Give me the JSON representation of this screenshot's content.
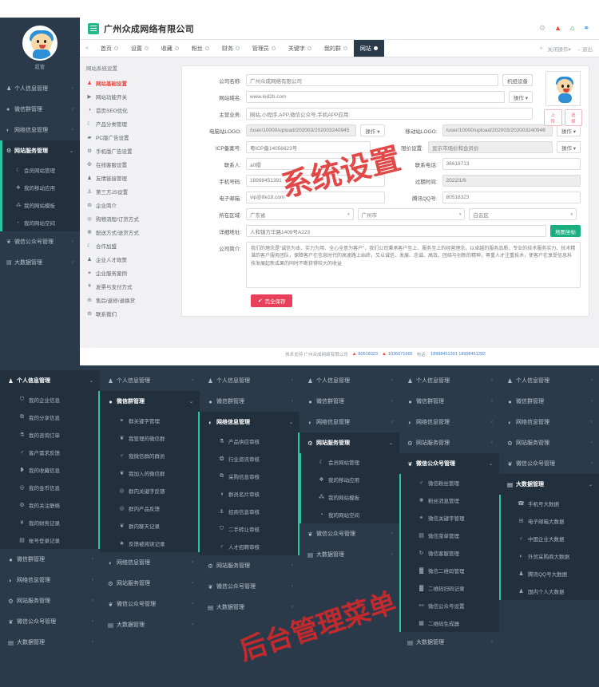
{
  "main": {
    "header": {
      "brand": "广州众成网络有限公司",
      "menu_icon": "hamburger-icon",
      "icons": [
        {
          "name": "gear-icon",
          "glyph": "⚙"
        },
        {
          "name": "bell-icon",
          "glyph": "▲"
        },
        {
          "name": "home-icon",
          "glyph": "⌂"
        },
        {
          "name": "link-icon",
          "glyph": "⚭"
        }
      ]
    },
    "tabbar": {
      "prev_glyph": "«",
      "tabs": [
        {
          "label": "首页",
          "dot": true,
          "active": false
        },
        {
          "label": "设置",
          "dot": true,
          "active": false
        },
        {
          "label": "收藏",
          "dot": true,
          "active": false
        },
        {
          "label": "粉丝",
          "dot": true,
          "active": false
        },
        {
          "label": "财务",
          "dot": true,
          "active": false
        },
        {
          "label": "管理员",
          "dot": true,
          "active": false
        },
        {
          "label": "关键字",
          "dot": true,
          "active": false
        },
        {
          "label": "我的群",
          "dot": true,
          "active": false
        },
        {
          "label": "网站",
          "dot": true,
          "active": true
        }
      ],
      "right": [
        {
          "label": "»"
        },
        {
          "label": "关闭操作▾"
        },
        {
          "label": "→ 退出"
        }
      ]
    },
    "sidebar": {
      "avatar_name": "超管",
      "items": [
        {
          "label": "个人信息管理",
          "icon": "user-icon",
          "glyph": "♟",
          "arrow": "‹",
          "active": false
        },
        {
          "label": "微信群管理",
          "icon": "chat-icon",
          "glyph": "●",
          "arrow": "‹",
          "active": false
        },
        {
          "label": "网络信息管理",
          "icon": "info-icon",
          "glyph": "◐",
          "arrow": "‹",
          "active": false
        },
        {
          "label": "网站服务管理",
          "icon": "gear-icon",
          "glyph": "⚙",
          "arrow": "⌄",
          "active": true
        }
      ],
      "sub_items": [
        {
          "label": "会员网站管理",
          "glyph": "☾"
        },
        {
          "label": "我的移动应用",
          "glyph": "❖"
        },
        {
          "label": "我的网站模板",
          "glyph": "⁂"
        },
        {
          "label": "我的网站空间",
          "glyph": "◔"
        }
      ],
      "tail_items": [
        {
          "label": "微信公众号管理",
          "glyph": "❦",
          "arrow": "‹"
        },
        {
          "label": "大数据管理",
          "glyph": "▤",
          "arrow": "‹"
        }
      ]
    },
    "submenu": {
      "title": "网站系统设置",
      "items": [
        {
          "label": "网站基础设置",
          "glyph": "♟",
          "selected": true
        },
        {
          "label": "网站功能开关",
          "glyph": "▶",
          "selected": false
        },
        {
          "label": "首页SEO优化",
          "glyph": "◑",
          "selected": false
        },
        {
          "label": "产品分类管理",
          "glyph": "☾",
          "selected": false
        },
        {
          "label": "PC版广告设置",
          "glyph": "▰",
          "selected": false
        },
        {
          "label": "手机版广告设置",
          "glyph": "⚙",
          "selected": false
        },
        {
          "label": "在线客服设置",
          "glyph": "✠",
          "selected": false
        },
        {
          "label": "友情链接管理",
          "glyph": "♟",
          "selected": false
        },
        {
          "label": "第三方JS设置",
          "glyph": "⚓",
          "selected": false
        },
        {
          "label": "企业简介",
          "glyph": "⚙",
          "selected": false
        },
        {
          "label": "购物流程/订货方式",
          "glyph": "◎",
          "selected": false
        },
        {
          "label": "配送方式/送货方式",
          "glyph": "☸",
          "selected": false
        },
        {
          "label": "合作加盟",
          "glyph": "☾",
          "selected": false
        },
        {
          "label": "企业人才政策",
          "glyph": "♟",
          "selected": false
        },
        {
          "label": "企业服务案例",
          "glyph": "⚭",
          "selected": false
        },
        {
          "label": "发票与支付方式",
          "glyph": "¥",
          "selected": false
        },
        {
          "label": "售后/返修/退换货",
          "glyph": "⚙",
          "selected": false
        },
        {
          "label": "联系我们",
          "glyph": "⚙",
          "selected": false
        }
      ]
    },
    "form": {
      "rows": [
        {
          "label": "公司名称:",
          "value": "广州众成网络有限公司",
          "btn": "机组设备",
          "grey": false
        },
        {
          "label": "网站域名:",
          "value": "www.led2b.com",
          "btn": "操作 ▾",
          "grey": false
        },
        {
          "label": "主营业务:",
          "value": "网站,小程序,APP,微信公众号,手机APP应用",
          "btn": "",
          "grey": false
        }
      ],
      "pair_rows": [
        {
          "left_label": "电脑站LOGO:",
          "left_value": "/user/10000/upload/202003/202003240945",
          "left_btn": "操作 ▾",
          "left_grey": true,
          "right_label": "移动站LOGO:",
          "right_value": "/user/10000/upload/202003/202003240946",
          "right_btn": "操作 ▾",
          "right_grey": true
        },
        {
          "left_label": "ICP备案号:",
          "left_value": "粤ICP备14056623号",
          "left_btn": "",
          "left_grey": false,
          "right_label": "限价设置:",
          "right_value": "显示市场价和会员价",
          "right_btn": "操作 ▾",
          "right_grey": true
        },
        {
          "left_label": "联系人:",
          "left_value": "a0帽",
          "left_btn": "",
          "left_grey": false,
          "right_label": "联系电话:",
          "right_value": "36618713",
          "right_btn": "",
          "right_grey": false
        },
        {
          "left_label": "手机号码:",
          "left_value": "18998451391",
          "left_btn": "",
          "left_grey": false,
          "right_label": "过期时间:",
          "right_value": "2022/1/6",
          "right_btn": "",
          "right_grey": true
        },
        {
          "left_label": "电子邮箱:",
          "left_value": "vip@8e18.com",
          "left_btn": "",
          "left_grey": false,
          "right_label": "腾讯QQ号:",
          "right_value": "80518323",
          "right_btn": "",
          "right_grey": false
        }
      ],
      "region": {
        "label": "所在区域:",
        "province": "广东省",
        "city": "广州市",
        "district": "白云区"
      },
      "address": {
        "label": "详细地址:",
        "value": "人和镇方华路1409号A223",
        "map_btn": "地图坐标"
      },
      "intro": {
        "label": "公司简介:",
        "value": "我们的理念是\"诚信为本、实力为用、全心全意为客户\"，我们公司秉承客户至上、服务至上的经营理念，以卓越的服务品质、专业的技术服务实力、技术精湛的客户服务团队，保障客户在信息时代的高速路上始终，又以诚信、发展、忠诚、高效、团结与创新的精神，尊重人才注重技术，使客户在享受信息科技发展起新成果的同时不断获得较大的收益"
      },
      "save_label": "完全保存",
      "logo_panel": {
        "upload_label": "上传",
        "choose_label": "选择"
      }
    },
    "footer": {
      "support": "技术支持 广州众成网络有限公司",
      "qq1": "80518323",
      "qq2": "1036671665",
      "phone_label": "电话:",
      "phones": "18998451391 18998451392"
    },
    "watermark": "系统设置"
  },
  "menus": {
    "watermark": "后台管理菜单",
    "panels": [
      {
        "rows": [
          {
            "label": "个人信息管理",
            "glyph": "♟",
            "arrow": "⌄",
            "open": true
          },
          {
            "label": "微信群管理",
            "glyph": "●",
            "arrow": "‹",
            "open": false
          },
          {
            "label": "网络信息管理",
            "glyph": "◐",
            "arrow": "‹",
            "open": false
          },
          {
            "label": "网站服务管理",
            "glyph": "⚙",
            "arrow": "‹",
            "open": false
          },
          {
            "label": "微信公众号管理",
            "glyph": "❦",
            "arrow": "‹",
            "open": false
          },
          {
            "label": "大数据管理",
            "glyph": "▤",
            "arrow": "‹",
            "open": false
          }
        ],
        "sub_after": 0,
        "sub_items": [
          {
            "label": "我的企业信息",
            "glyph": "⛉"
          },
          {
            "label": "我的分享信息",
            "glyph": "⧉"
          },
          {
            "label": "我的咨询订单",
            "glyph": "⚗"
          },
          {
            "label": "客户需求反馈",
            "glyph": "♂"
          },
          {
            "label": "我的收藏信息",
            "glyph": "❥"
          },
          {
            "label": "我的金币信息",
            "glyph": "◎"
          },
          {
            "label": "我的关注联络",
            "glyph": "⚙"
          },
          {
            "label": "我的财务记录",
            "glyph": "¥"
          },
          {
            "label": "帐号登录记录",
            "glyph": "▤"
          }
        ]
      },
      {
        "rows": [
          {
            "label": "个人信息管理",
            "glyph": "♟",
            "arrow": "‹",
            "open": false
          },
          {
            "label": "微信群管理",
            "glyph": "●",
            "arrow": "⌄",
            "open": true
          },
          {
            "label": "网络信息管理",
            "glyph": "◐",
            "arrow": "‹",
            "open": false
          },
          {
            "label": "网站服务管理",
            "glyph": "⚙",
            "arrow": "‹",
            "open": false
          },
          {
            "label": "微信公众号管理",
            "glyph": "❦",
            "arrow": "‹",
            "open": false
          },
          {
            "label": "大数据管理",
            "glyph": "▤",
            "arrow": "‹",
            "open": false
          }
        ],
        "sub_after": 1,
        "sub_items": [
          {
            "label": "群关键字管理",
            "glyph": "⚭"
          },
          {
            "label": "我管理的微信群",
            "glyph": "❦"
          },
          {
            "label": "我微信群的群员",
            "glyph": "♂"
          },
          {
            "label": "我加入的微信群",
            "glyph": "❦"
          },
          {
            "label": "群内关键字反馈",
            "glyph": "◎"
          },
          {
            "label": "群内产品反馈",
            "glyph": "◎"
          },
          {
            "label": "群内聊天记录",
            "glyph": "❦"
          },
          {
            "label": "反馈被阅读记录",
            "glyph": "★"
          }
        ]
      },
      {
        "rows": [
          {
            "label": "个人信息管理",
            "glyph": "♟",
            "arrow": "‹",
            "open": false
          },
          {
            "label": "微信群管理",
            "glyph": "●",
            "arrow": "‹",
            "open": false
          },
          {
            "label": "网络信息管理",
            "glyph": "◐",
            "arrow": "⌄",
            "open": true
          },
          {
            "label": "网站服务管理",
            "glyph": "⚙",
            "arrow": "‹",
            "open": false
          },
          {
            "label": "微信公众号管理",
            "glyph": "❦",
            "arrow": "‹",
            "open": false
          },
          {
            "label": "大数据管理",
            "glyph": "▤",
            "arrow": "‹",
            "open": false
          }
        ],
        "sub_after": 2,
        "sub_items": [
          {
            "label": "产品供应审核",
            "glyph": "⚗"
          },
          {
            "label": "行业资讯审核",
            "glyph": "❂"
          },
          {
            "label": "采购信息审核",
            "glyph": "⧉"
          },
          {
            "label": "群员名片审核",
            "glyph": "◑"
          },
          {
            "label": "招商信息审核",
            "glyph": "⚓"
          },
          {
            "label": "二手转让审核",
            "glyph": "⛉"
          },
          {
            "label": "人才招聘审核",
            "glyph": "♂"
          }
        ]
      },
      {
        "rows": [
          {
            "label": "个人信息管理",
            "glyph": "♟",
            "arrow": "‹",
            "open": false
          },
          {
            "label": "微信群管理",
            "glyph": "●",
            "arrow": "‹",
            "open": false
          },
          {
            "label": "网络信息管理",
            "glyph": "◐",
            "arrow": "‹",
            "open": false
          },
          {
            "label": "网站服务管理",
            "glyph": "⚙",
            "arrow": "⌄",
            "open": true
          },
          {
            "label": "微信公众号管理",
            "glyph": "❦",
            "arrow": "‹",
            "open": false
          },
          {
            "label": "大数据管理",
            "glyph": "▤",
            "arrow": "‹",
            "open": false
          }
        ],
        "sub_after": 3,
        "sub_items": [
          {
            "label": "会员网站管理",
            "glyph": "☾"
          },
          {
            "label": "我的移动应用",
            "glyph": "❖"
          },
          {
            "label": "我的网站模板",
            "glyph": "⁂"
          },
          {
            "label": "我的网站空间",
            "glyph": "◔"
          }
        ]
      },
      {
        "rows": [
          {
            "label": "个人信息管理",
            "glyph": "♟",
            "arrow": "‹",
            "open": false
          },
          {
            "label": "微信群管理",
            "glyph": "●",
            "arrow": "‹",
            "open": false
          },
          {
            "label": "网络信息管理",
            "glyph": "◐",
            "arrow": "‹",
            "open": false
          },
          {
            "label": "网站服务管理",
            "glyph": "⚙",
            "arrow": "‹",
            "open": false
          },
          {
            "label": "微信公众号管理",
            "glyph": "❦",
            "arrow": "⌄",
            "open": true
          },
          {
            "label": "大数据管理",
            "glyph": "▤",
            "arrow": "‹",
            "open": false
          }
        ],
        "sub_after": 4,
        "sub_items": [
          {
            "label": "微信粉丝管理",
            "glyph": "♂"
          },
          {
            "label": "粉丝消息管理",
            "glyph": "❀"
          },
          {
            "label": "微信关键字管理",
            "glyph": "⚭"
          },
          {
            "label": "微信菜单管理",
            "glyph": "▤"
          },
          {
            "label": "微信客服管理",
            "glyph": "↻"
          },
          {
            "label": "微信二维码管理",
            "glyph": "▓"
          },
          {
            "label": "二维码扫码记录",
            "glyph": "▓"
          },
          {
            "label": "微信公众号设置",
            "glyph": "⚯"
          },
          {
            "label": "二维码生成器",
            "glyph": "▦"
          }
        ]
      },
      {
        "rows": [
          {
            "label": "个人信息管理",
            "glyph": "♟",
            "arrow": "‹",
            "open": false
          },
          {
            "label": "微信群管理",
            "glyph": "●",
            "arrow": "‹",
            "open": false
          },
          {
            "label": "网络信息管理",
            "glyph": "◐",
            "arrow": "‹",
            "open": false
          },
          {
            "label": "网站服务管理",
            "glyph": "⚙",
            "arrow": "‹",
            "open": false
          },
          {
            "label": "微信公众号管理",
            "glyph": "❦",
            "arrow": "‹",
            "open": false
          },
          {
            "label": "大数据管理",
            "glyph": "▤",
            "arrow": "⌄",
            "open": true
          }
        ],
        "sub_after": 5,
        "sub_items": [
          {
            "label": "手机号大数据",
            "glyph": "☎"
          },
          {
            "label": "电子邮箱大数据",
            "glyph": "✉"
          },
          {
            "label": "中国企业大数据",
            "glyph": "♂"
          },
          {
            "label": "外贸采购商大数据",
            "glyph": "◐"
          },
          {
            "label": "腾讯QQ号大数据",
            "glyph": "♟"
          },
          {
            "label": "国内个人大数据",
            "glyph": "♟"
          }
        ]
      }
    ]
  }
}
